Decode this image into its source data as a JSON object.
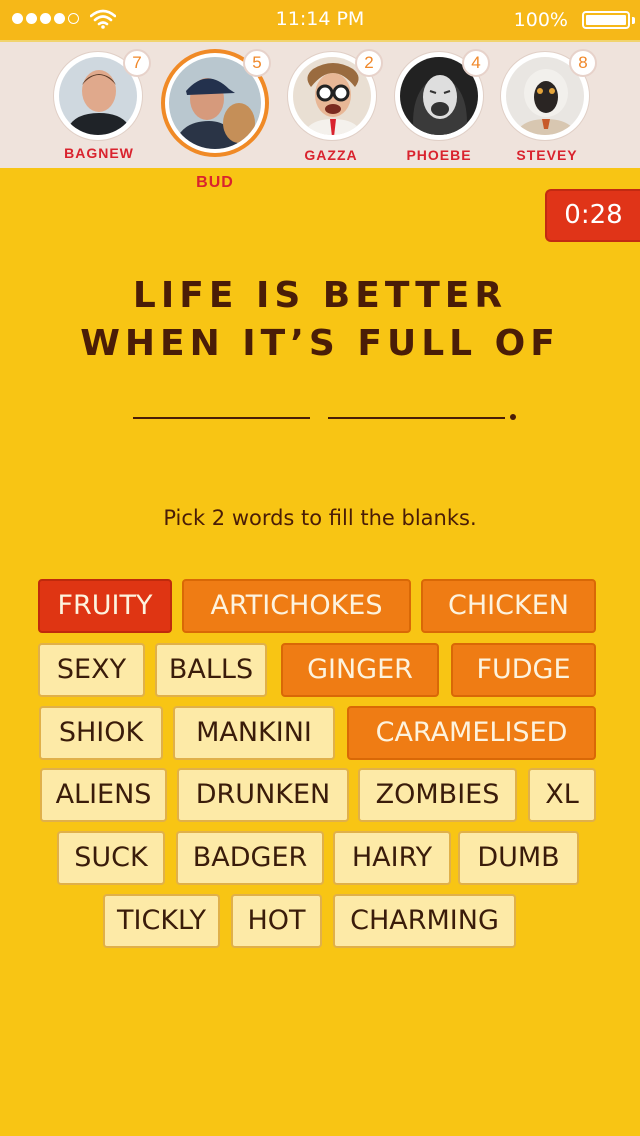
{
  "status_bar": {
    "time": "11:14 PM",
    "battery": "100%"
  },
  "players": [
    {
      "name": "BAGNEW",
      "score": "7"
    },
    {
      "name": "BUD",
      "score": "5"
    },
    {
      "name": "GAZZA",
      "score": "2"
    },
    {
      "name": "PHOEBE",
      "score": "4"
    },
    {
      "name": "STEVEY",
      "score": "8"
    }
  ],
  "timer": "0:28",
  "prompt": {
    "line1": "LIFE IS BETTER",
    "line2": "WHEN IT’S FULL OF"
  },
  "instruction": "Pick 2 words to fill the blanks.",
  "words": [
    {
      "label": "FRUITY",
      "state": "selected"
    },
    {
      "label": "ARTICHOKES",
      "state": "highlighted"
    },
    {
      "label": "CHICKEN",
      "state": "highlighted"
    },
    {
      "label": "SEXY",
      "state": "normal"
    },
    {
      "label": "BALLS",
      "state": "normal"
    },
    {
      "label": "GINGER",
      "state": "highlighted"
    },
    {
      "label": "FUDGE",
      "state": "highlighted"
    },
    {
      "label": "SHIOK",
      "state": "normal"
    },
    {
      "label": "MANKINI",
      "state": "normal"
    },
    {
      "label": "CARAMELISED",
      "state": "highlighted"
    },
    {
      "label": "ALIENS",
      "state": "normal"
    },
    {
      "label": "DRUNKEN",
      "state": "normal"
    },
    {
      "label": "ZOMBIES",
      "state": "normal"
    },
    {
      "label": "XL",
      "state": "normal"
    },
    {
      "label": "SUCK",
      "state": "normal"
    },
    {
      "label": "BADGER",
      "state": "normal"
    },
    {
      "label": "HAIRY",
      "state": "normal"
    },
    {
      "label": "DUMB",
      "state": "normal"
    },
    {
      "label": "TICKLY",
      "state": "normal"
    },
    {
      "label": "HOT",
      "state": "normal"
    },
    {
      "label": "CHARMING",
      "state": "normal"
    }
  ],
  "colors": {
    "background": "#f8c514",
    "selected": "#df3513",
    "highlighted": "#ef7c14",
    "active_player_ring": "#f08a26"
  }
}
